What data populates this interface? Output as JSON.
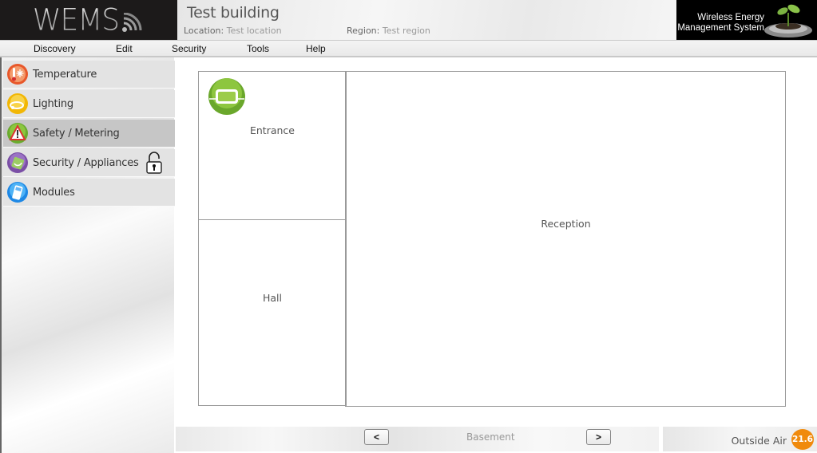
{
  "header": {
    "logo": "WEMS",
    "building_title": "Test building",
    "location_label": "Location:",
    "location_value": "Test location",
    "region_label": "Region:",
    "region_value": "Test region",
    "brand_line1": "Wireless Energy",
    "brand_line2": "Management System"
  },
  "menu": [
    {
      "label": "Discovery"
    },
    {
      "label": "Edit"
    },
    {
      "label": "Security"
    },
    {
      "label": "Tools"
    },
    {
      "label": "Help"
    }
  ],
  "sidebar": {
    "items": [
      {
        "label": "Temperature",
        "icon": "thermometer-snowflake-icon",
        "active": false
      },
      {
        "label": "Lighting",
        "icon": "light-bulb-icon",
        "active": false
      },
      {
        "label": "Safety / Metering",
        "icon": "warning-icon",
        "active": true
      },
      {
        "label": "Security / Appliances",
        "icon": "security-appliance-icon",
        "active": false,
        "locked": true
      },
      {
        "label": "Modules",
        "icon": "module-device-icon",
        "active": false
      }
    ]
  },
  "floorplan": {
    "rooms": [
      {
        "name": "Entrance",
        "device_icon": "green-sensor-module-icon"
      },
      {
        "name": "Hall"
      },
      {
        "name": "Reception"
      }
    ]
  },
  "footer": {
    "prev_label": "<",
    "next_label": ">",
    "floor_name": "Basement",
    "outside_label": "Outside Air",
    "outside_value": "21.6",
    "outside_color": "#f08a0c"
  }
}
